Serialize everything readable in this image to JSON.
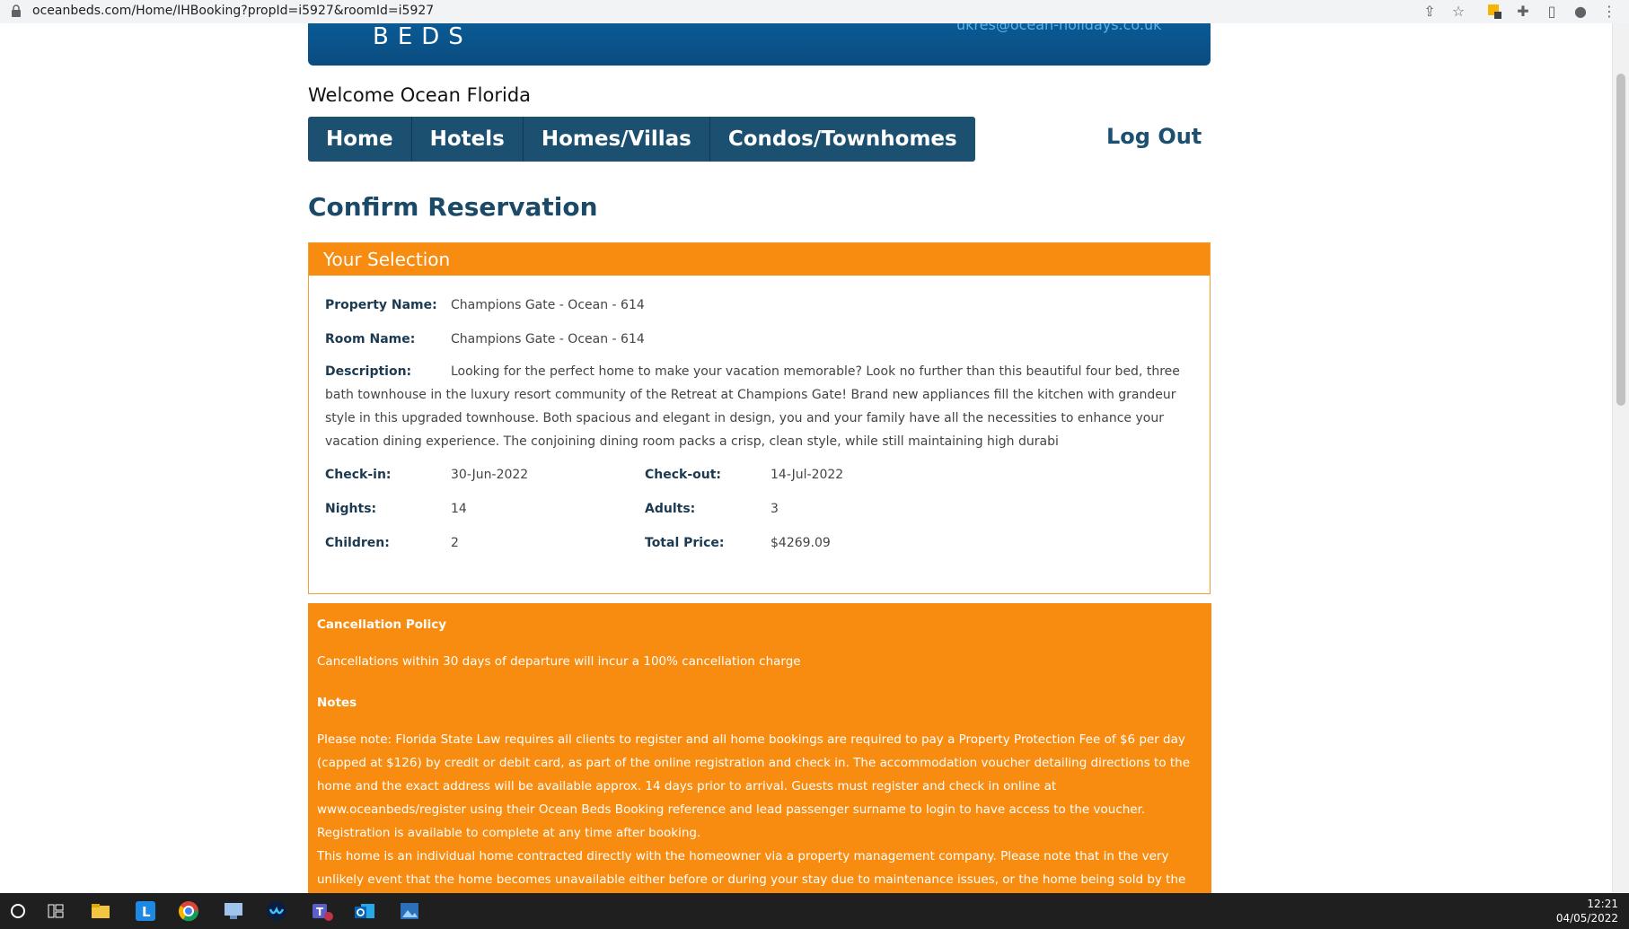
{
  "browser": {
    "url": "oceanbeds.com/Home/IHBooking?propId=i5927&roomId=i5927"
  },
  "header": {
    "logo_text": "BEDS",
    "email": "ukres@ocean-holidays.co.uk",
    "welcome": "Welcome Ocean Florida"
  },
  "nav": {
    "items": [
      "Home",
      "Hotels",
      "Homes/Villas",
      "Condos/Townhomes"
    ],
    "logout": "Log Out"
  },
  "page": {
    "title": "Confirm Reservation"
  },
  "selection": {
    "heading": "Your Selection",
    "property_name_label": "Property Name:",
    "property_name": "Champions Gate - Ocean - 614",
    "room_name_label": "Room Name:",
    "room_name": "Champions Gate - Ocean - 614",
    "description_label": "Description:",
    "description": "Looking for the perfect home to make your vacation memorable? Look no further than this beautiful four bed, three bath townhouse in the luxury resort community of the Retreat at Champions Gate! Brand new appliances fill the kitchen with grandeur style in this upgraded townhouse. Both spacious and elegant in design, you and your family have all the necessities to enhance your vacation dining experience. The conjoining dining room packs a crisp, clean style, while still maintaining high durabi",
    "checkin_label": "Check-in:",
    "checkin": "30-Jun-2022",
    "checkout_label": "Check-out:",
    "checkout": "14-Jul-2022",
    "nights_label": "Nights:",
    "nights": "14",
    "adults_label": "Adults:",
    "adults": "3",
    "children_label": "Children:",
    "children": "2",
    "total_label": "Total Price:",
    "total": "$4269.09"
  },
  "policy": {
    "cancel_heading": "Cancellation Policy",
    "cancel_text": "Cancellations within 30 days of departure will incur a 100% cancellation charge",
    "notes_heading": "Notes",
    "notes_text": "Please note: Florida State Law requires all clients to register and all home bookings are required to pay a Property Protection Fee of $6 per day (capped at $126) by credit or debit card, as part of the online registration and check in. The accommodation voucher detailing directions to the home and the exact address will be available approx. 14 days prior to arrival. Guests must register and check in online at www.oceanbeds/register using their Ocean Beds Booking reference and lead passenger surname to login to have access to the voucher. Registration is available to complete at any time after booking.",
    "home_text": "This home is an individual home contracted directly with the homeowner via a property management company. Please note that in the very unlikely event that the home becomes unavailable either before or during your stay due to maintenance issues, or the home being sold by the homeowner, you will be"
  },
  "taskbar": {
    "time": "12:21",
    "date": "04/05/2022"
  },
  "colors": {
    "brand_blue": "#1b5070",
    "accent_orange": "#f78c10"
  }
}
